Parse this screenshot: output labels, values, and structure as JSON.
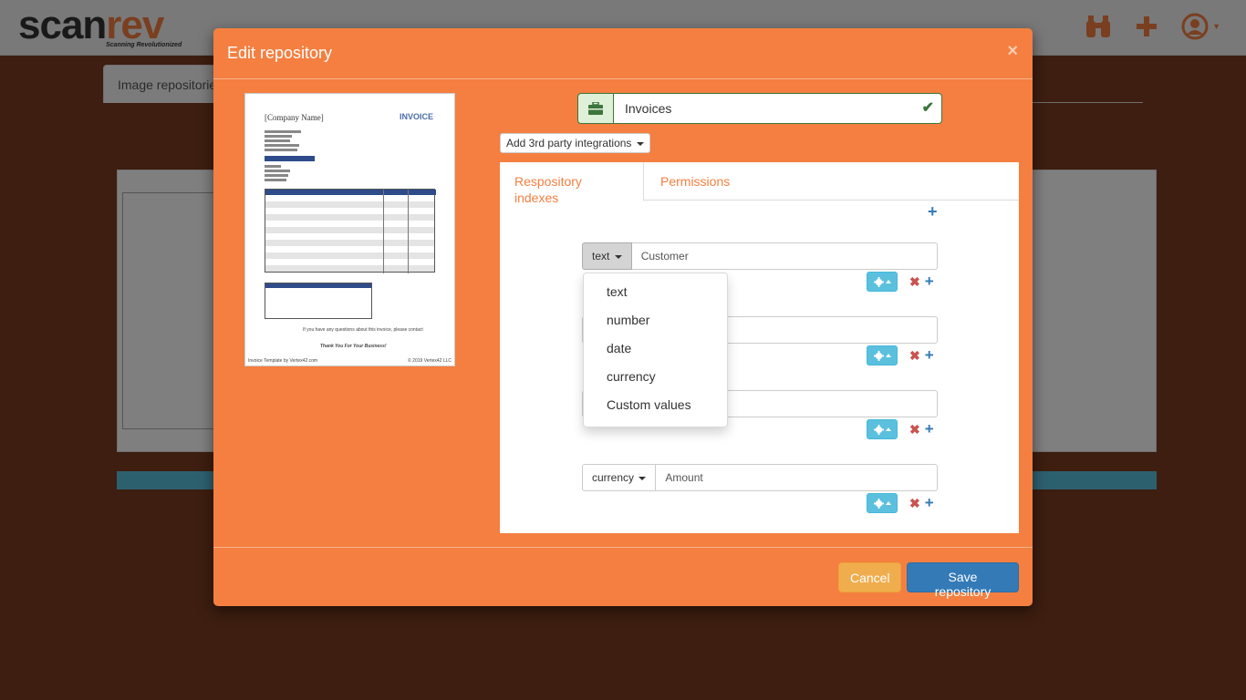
{
  "app": {
    "logo_scan": "scan",
    "logo_rev": "rev",
    "logo_tagline": "Scanning Revolutionized",
    "icons": [
      "binoculars-icon",
      "plus-icon",
      "user-circle-icon"
    ]
  },
  "background": {
    "tab_label": "Image repositories"
  },
  "modal": {
    "title": "Edit repository",
    "close_label": "×",
    "repository_name": "Invoices",
    "integrations_label": "Add 3rd party integrations",
    "tabs": [
      {
        "label": "Respository indexes",
        "active": true
      },
      {
        "label": "Permissions",
        "active": false
      }
    ],
    "indexes": [
      {
        "type": "text",
        "value": "Customer"
      },
      {
        "type": "",
        "value": ""
      },
      {
        "type": "",
        "value": ""
      },
      {
        "type": "currency",
        "value": "Amount"
      }
    ],
    "type_options": [
      "text",
      "number",
      "date",
      "currency",
      "Custom values"
    ],
    "cancel_label": "Cancel",
    "save_label": "Save repository"
  },
  "preview": {
    "company": "[Company Name]",
    "title": "INVOICE",
    "footer_left": "Invoice Template by Vertex42.com",
    "footer_right": "© 2019 Vertex42 LLC",
    "thanks": "Thank You For Your Business!"
  },
  "colors": {
    "modal_bg": "#f47f40",
    "accent_blue": "#337ab7",
    "info": "#5bc0de",
    "warning": "#f0ad4e",
    "success": "#3c763d"
  }
}
